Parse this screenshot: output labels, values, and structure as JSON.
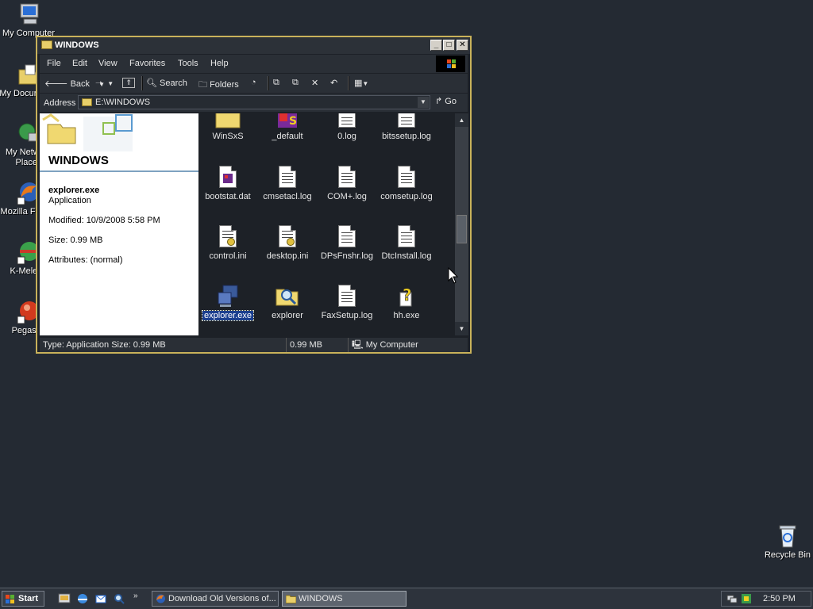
{
  "desktop": {
    "icons": [
      {
        "label": "My Computer",
        "icon": "my-computer-icon"
      },
      {
        "label": "My Documents",
        "icon": "my-documents-icon"
      },
      {
        "label": "My Network Places",
        "icon": "network-places-icon"
      },
      {
        "label": "Mozilla Firefox",
        "icon": "firefox-icon"
      },
      {
        "label": "K-Meleon",
        "icon": "k-meleon-icon"
      },
      {
        "label": "Pegasus",
        "icon": "pegasus-icon"
      },
      {
        "label": "Recycle Bin",
        "icon": "recycle-bin-icon"
      }
    ]
  },
  "window": {
    "title": "WINDOWS",
    "controls": {
      "minimize": "_",
      "maximize": "□",
      "close": "✕"
    },
    "menu": [
      "File",
      "Edit",
      "View",
      "Favorites",
      "Tools",
      "Help"
    ],
    "toolbar": {
      "back": "Back",
      "search": "Search",
      "folders": "Folders"
    },
    "address": {
      "label": "Address",
      "value": "E:\\WINDOWS",
      "go": "Go"
    },
    "info": {
      "folder_title": "WINDOWS",
      "file_name": "explorer.exe",
      "file_type": "Application",
      "modified": "Modified: 10/9/2008 5:58 PM",
      "size": "Size: 0.99 MB",
      "attributes": "Attributes: (normal)"
    },
    "files": [
      {
        "label": "WinSxS",
        "icon": "folder-icon"
      },
      {
        "label": "_default",
        "icon": "default-app-icon"
      },
      {
        "label": "0.log",
        "icon": "text-file-icon"
      },
      {
        "label": "bitssetup.log",
        "icon": "text-file-icon"
      },
      {
        "label": "bootstat.dat",
        "icon": "dat-file-icon"
      },
      {
        "label": "cmsetacl.log",
        "icon": "text-file-icon"
      },
      {
        "label": "COM+.log",
        "icon": "text-file-icon"
      },
      {
        "label": "comsetup.log",
        "icon": "text-file-icon"
      },
      {
        "label": "control.ini",
        "icon": "ini-file-icon"
      },
      {
        "label": "desktop.ini",
        "icon": "ini-file-icon"
      },
      {
        "label": "DPsFnshr.log",
        "icon": "text-file-icon"
      },
      {
        "label": "DtcInstall.log",
        "icon": "text-file-icon"
      },
      {
        "label": "explorer.exe",
        "icon": "explorer-exe-icon",
        "selected": true
      },
      {
        "label": "explorer",
        "icon": "explorer-search-icon"
      },
      {
        "label": "FaxSetup.log",
        "icon": "text-file-icon"
      },
      {
        "label": "hh.exe",
        "icon": "help-exe-icon"
      }
    ],
    "status": {
      "left": "Type: Application Size: 0.99 MB",
      "size": "0.99 MB",
      "zone": "My Computer"
    }
  },
  "taskbar": {
    "start": "Start",
    "tasks": [
      {
        "label": "Download Old Versions of...",
        "icon": "firefox-icon",
        "active": false
      },
      {
        "label": "WINDOWS",
        "icon": "folder-icon",
        "active": true
      }
    ],
    "clock": "2:50 PM"
  }
}
